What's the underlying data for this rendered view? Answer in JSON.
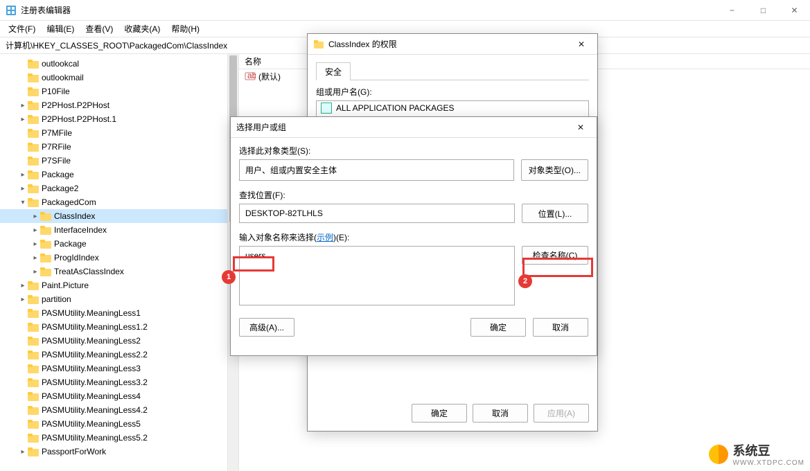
{
  "app": {
    "title": "注册表编辑器",
    "min": "−",
    "max": "□",
    "close": "✕"
  },
  "menu": {
    "file": "文件(F)",
    "edit": "编辑(E)",
    "view": "查看(V)",
    "favorites": "收藏夹(A)",
    "help": "帮助(H)"
  },
  "address": "计算机\\HKEY_CLASSES_ROOT\\PackagedCom\\ClassIndex",
  "tree": [
    {
      "indent": 1,
      "twisty": "",
      "label": "outlookcal"
    },
    {
      "indent": 1,
      "twisty": "",
      "label": "outlookmail"
    },
    {
      "indent": 1,
      "twisty": "",
      "label": "P10File"
    },
    {
      "indent": 1,
      "twisty": "r",
      "label": "P2PHost.P2PHost"
    },
    {
      "indent": 1,
      "twisty": "r",
      "label": "P2PHost.P2PHost.1"
    },
    {
      "indent": 1,
      "twisty": "",
      "label": "P7MFile"
    },
    {
      "indent": 1,
      "twisty": "",
      "label": "P7RFile"
    },
    {
      "indent": 1,
      "twisty": "",
      "label": "P7SFile"
    },
    {
      "indent": 1,
      "twisty": "r",
      "label": "Package"
    },
    {
      "indent": 1,
      "twisty": "r",
      "label": "Package2"
    },
    {
      "indent": 1,
      "twisty": "d",
      "label": "PackagedCom"
    },
    {
      "indent": 2,
      "twisty": "r",
      "label": "ClassIndex",
      "sel": true
    },
    {
      "indent": 2,
      "twisty": "r",
      "label": "InterfaceIndex"
    },
    {
      "indent": 2,
      "twisty": "r",
      "label": "Package"
    },
    {
      "indent": 2,
      "twisty": "r",
      "label": "ProgIdIndex"
    },
    {
      "indent": 2,
      "twisty": "r",
      "label": "TreatAsClassIndex"
    },
    {
      "indent": 1,
      "twisty": "r",
      "label": "Paint.Picture"
    },
    {
      "indent": 1,
      "twisty": "r",
      "label": "partition"
    },
    {
      "indent": 1,
      "twisty": "",
      "label": "PASMUtility.MeaningLess1"
    },
    {
      "indent": 1,
      "twisty": "",
      "label": "PASMUtility.MeaningLess1.2"
    },
    {
      "indent": 1,
      "twisty": "",
      "label": "PASMUtility.MeaningLess2"
    },
    {
      "indent": 1,
      "twisty": "",
      "label": "PASMUtility.MeaningLess2.2"
    },
    {
      "indent": 1,
      "twisty": "",
      "label": "PASMUtility.MeaningLess3"
    },
    {
      "indent": 1,
      "twisty": "",
      "label": "PASMUtility.MeaningLess3.2"
    },
    {
      "indent": 1,
      "twisty": "",
      "label": "PASMUtility.MeaningLess4"
    },
    {
      "indent": 1,
      "twisty": "",
      "label": "PASMUtility.MeaningLess4.2"
    },
    {
      "indent": 1,
      "twisty": "",
      "label": "PASMUtility.MeaningLess5"
    },
    {
      "indent": 1,
      "twisty": "",
      "label": "PASMUtility.MeaningLess5.2"
    },
    {
      "indent": 1,
      "twisty": "r",
      "label": "PassportForWork"
    }
  ],
  "list": {
    "header_name": "名称",
    "default_value": "(默认)"
  },
  "perm_dialog": {
    "title": "ClassIndex 的权限",
    "tab_security": "安全",
    "group_label": "组或用户名(G):",
    "principal": "ALL APPLICATION PACKAGES",
    "ok": "确定",
    "cancel": "取消",
    "apply": "应用(A)"
  },
  "select_dialog": {
    "title": "选择用户或组",
    "close": "✕",
    "obj_type_label": "选择此对象类型(S):",
    "obj_type_value": "用户、组或内置安全主体",
    "obj_type_btn": "对象类型(O)...",
    "location_label": "查找位置(F):",
    "location_value": "DESKTOP-82TLHLS",
    "location_btn": "位置(L)...",
    "name_label_prefix": "输入对象名称来选择(",
    "name_label_link": "示例",
    "name_label_suffix": ")(E):",
    "name_value": "users",
    "check_names_btn": "检查名称(C)",
    "advanced_btn": "高级(A)...",
    "ok": "确定",
    "cancel": "取消"
  },
  "annotations": {
    "n1": "1",
    "n2": "2"
  },
  "watermark": {
    "brand": "系统豆",
    "url": "WWW.XTDPC.COM"
  }
}
